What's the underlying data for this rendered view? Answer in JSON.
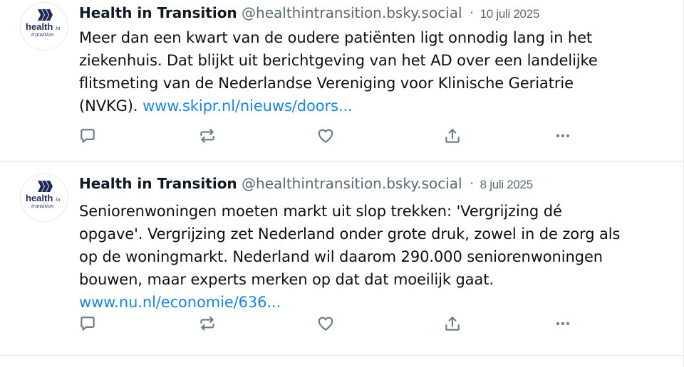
{
  "posts": [
    {
      "author_name": "Health in Transition",
      "handle": "@healthintransition.bsky.social",
      "separator": "·",
      "date": "10 juli 2025",
      "text_lines": [
        "Meer dan een kwart van de oudere patiënten ligt onnodig lang in het",
        "ziekenhuis. Dat blijkt uit berichtgeving van het AD over een landelijke",
        "flitsmeting van de Nederlandse Vereniging voor Klinische Geriatrie",
        "(NVKG). "
      ],
      "link": "www.skipr.nl/nieuws/doors...",
      "avatar": {
        "brand": "health",
        "suffix": "in",
        "subtitle": "transition"
      },
      "actions": [
        "reply-icon",
        "repost-icon",
        "like-icon",
        "share-icon",
        "more-icon"
      ]
    },
    {
      "author_name": "Health in Transition",
      "handle": "@healthintransition.bsky.social",
      "separator": "·",
      "date": "8 juli 2025",
      "text_lines": [
        "Seniorenwoningen moeten markt uit slop trekken: 'Vergrijzing dé",
        "opgave'. Vergrijzing zet Nederland onder grote druk, zowel in de zorg als",
        "op de woningmarkt. Nederland wil daarom 290.000 seniorenwoningen",
        "bouwen, maar experts merken op dat dat moeilijk gaat."
      ],
      "link": "www.nu.nl/economie/636...",
      "avatar": {
        "brand": "health",
        "suffix": "in",
        "subtitle": "transition"
      },
      "actions": [
        "reply-icon",
        "repost-icon",
        "like-icon",
        "share-icon",
        "more-icon"
      ]
    }
  ],
  "colors": {
    "text": "#0b0f14",
    "muted": "#5b6673",
    "link": "#1a84e8",
    "icon": "#6f7b88",
    "divider": "#e4e7ea",
    "logo_navy": "#1f2a5a"
  }
}
